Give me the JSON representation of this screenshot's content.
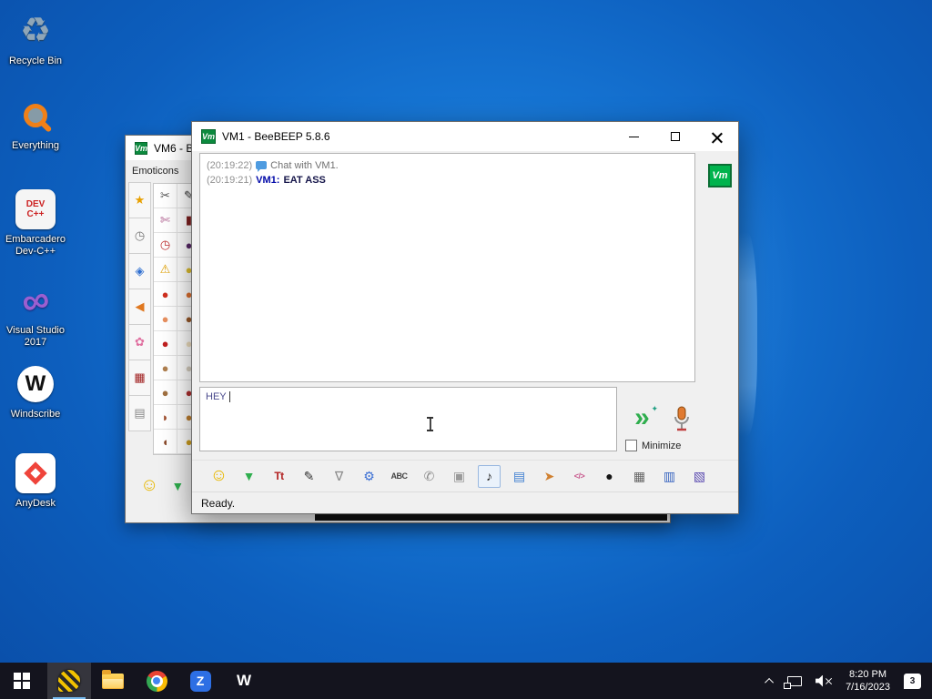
{
  "desktop": {
    "icons": [
      {
        "label": "Recycle Bin"
      },
      {
        "label": "Everything"
      },
      {
        "label": "Embarcadero Dev-C++"
      },
      {
        "label": "Visual Studio 2017"
      },
      {
        "label": "Windscribe"
      },
      {
        "label": "AnyDesk"
      }
    ],
    "devc_line1": "DEV",
    "devc_line2": "C++",
    "vs_glyph": "∞",
    "windscribe_glyph": "W",
    "recycle_glyph": "♻"
  },
  "bg_window": {
    "icon_text": "Vm",
    "title": "VM6 - Be",
    "emoticons_label": "Emoticons",
    "rail": [
      {
        "g": "★",
        "c": "#e8a000"
      },
      {
        "g": "◷",
        "c": "#777777"
      },
      {
        "g": "◈",
        "c": "#2f6fd0"
      },
      {
        "g": "◀",
        "c": "#e07820"
      },
      {
        "g": "✿",
        "c": "#e070a0"
      },
      {
        "g": "▦",
        "c": "#a02020"
      },
      {
        "g": "▤",
        "c": "#888888"
      }
    ],
    "grid1": [
      {
        "g": "✂",
        "c": "#555555"
      },
      {
        "g": "✄",
        "c": "#b06090"
      },
      {
        "g": "◷",
        "c": "#c03030"
      },
      {
        "g": "⚠",
        "c": "#e0a000"
      },
      {
        "g": "●",
        "c": "#d03020"
      },
      {
        "g": "●",
        "c": "#e89060"
      },
      {
        "g": "●",
        "c": "#c02020"
      },
      {
        "g": "●",
        "c": "#b08050"
      },
      {
        "g": "●",
        "c": "#a07040"
      },
      {
        "g": "◗",
        "c": "#a05030"
      },
      {
        "g": "◖",
        "c": "#8a4a2a"
      }
    ],
    "grid2": [
      {
        "g": "✎",
        "c": "#333333"
      },
      {
        "g": "▮",
        "c": "#802020"
      },
      {
        "g": "●",
        "c": "#5a2a6a"
      },
      {
        "g": "●",
        "c": "#e0c030"
      },
      {
        "g": "●",
        "c": "#e07030"
      },
      {
        "g": "●",
        "c": "#9a5a2a"
      },
      {
        "g": "●",
        "c": "#f0e0c0"
      },
      {
        "g": "●",
        "c": "#d8d0c0"
      },
      {
        "g": "●",
        "c": "#b03030"
      },
      {
        "g": "●",
        "c": "#c08030"
      },
      {
        "g": "●",
        "c": "#d0a020"
      }
    ],
    "smiley": {
      "g": "☺",
      "c": "#e8b800"
    },
    "arrow": {
      "g": "▼",
      "c": "#2fae4e"
    }
  },
  "chat_window": {
    "icon_text": "Vm",
    "title": "VM1 - BeeBEEP 5.8.6",
    "messages": {
      "m1_time": "(20:19:22)",
      "m1_text": "Chat with VM1.",
      "m2_time": "(20:19:21)",
      "m2_sender": "VM1:",
      "m2_text": "EAT ASS"
    },
    "avatar_text": "Vm",
    "input_value": "HEY",
    "send_glyph": "»",
    "send_spark": "✦",
    "minimize_checkbox_label": "Minimize",
    "toolbar": [
      {
        "g": "☺",
        "c": "#e8b800"
      },
      {
        "g": "▼",
        "c": "#2fae4e"
      },
      {
        "g": "Tt",
        "c": "#b22222"
      },
      {
        "g": "✎",
        "c": "#333333"
      },
      {
        "g": "∇",
        "c": "#8a8a8a"
      },
      {
        "g": "⚙",
        "c": "#3b6fd4"
      },
      {
        "g": "ABC",
        "c": "#444444"
      },
      {
        "g": "✆",
        "c": "#8a8a8a"
      },
      {
        "g": "▣",
        "c": "#9a9a9a"
      },
      {
        "g": "♪",
        "c": "#222222"
      },
      {
        "g": "▤",
        "c": "#3f7fd0"
      },
      {
        "g": "➤",
        "c": "#d08030"
      },
      {
        "g": "</>",
        "c": "#c85a8e"
      },
      {
        "g": "●",
        "c": "#151515"
      },
      {
        "g": "▦",
        "c": "#666666"
      },
      {
        "g": "▥",
        "c": "#3a66c0"
      },
      {
        "g": "▧",
        "c": "#5a4ab0"
      }
    ],
    "status": "Ready."
  },
  "taskbar": {
    "zicon_letter": "Z",
    "windscribe_letter": "W",
    "tray": {
      "time": "8:20 PM",
      "date": "7/16/2023",
      "notification_count": "3"
    }
  },
  "colors": {
    "accent_green": "#00b34d",
    "sender_blue": "#0008a8",
    "taskbar_bg": "#14141e",
    "desktop_blue": "#1573d2"
  }
}
